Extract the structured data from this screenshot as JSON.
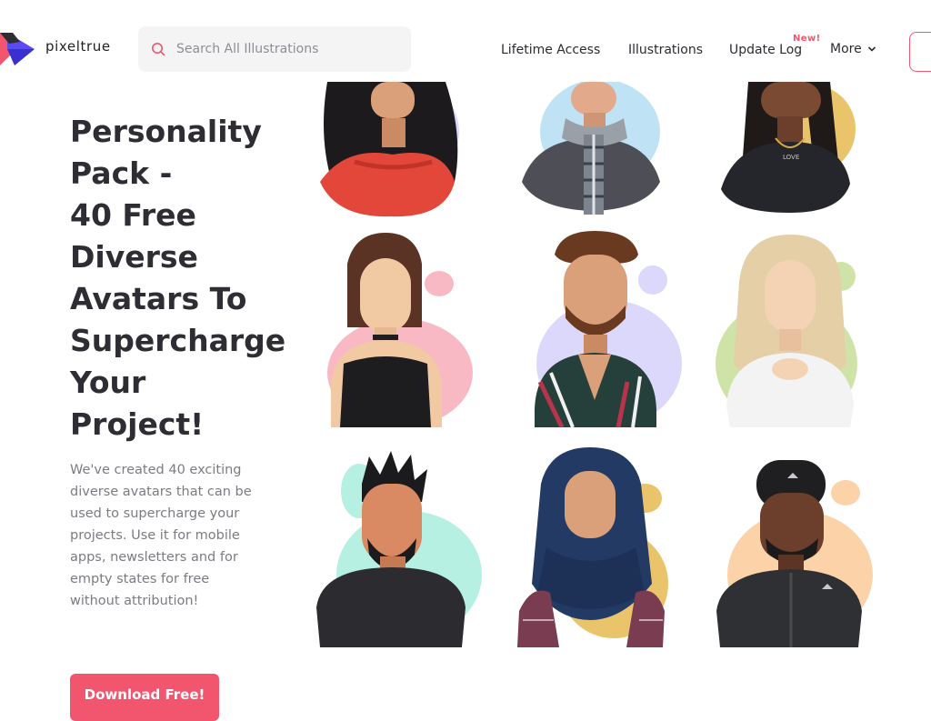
{
  "brand": {
    "name": "pixeltrue"
  },
  "search": {
    "placeholder": "Search All Illustrations"
  },
  "nav": {
    "items": [
      {
        "label": "Lifetime Access"
      },
      {
        "label": "Illustrations"
      },
      {
        "label": "Update Log"
      }
    ],
    "badge": "New!",
    "more_label": "More"
  },
  "hero": {
    "title_lines": [
      "Personality",
      "Pack -",
      "40 Free",
      "Diverse",
      "Avatars To",
      "Supercharge",
      "Your",
      "Project!"
    ],
    "description": "We've created 40 exciting diverse avatars that can be used to supercharge your projects. Use it for mobile apps, newsletters and for empty states for free without attribution!",
    "cta_label": "Download Free!"
  },
  "colors": {
    "accent": "#f1566e",
    "blob_lavender": "#dcd8fb",
    "blob_sky": "#bfe3f4",
    "blob_mustard": "#e9c46a",
    "blob_pink": "#f8b9c4",
    "blob_lime": "#cfe3a8",
    "blob_mint": "#b6f0e2",
    "blob_peach": "#fcd3a8"
  },
  "avatars": [
    {
      "name": "woman-red-top-avatar"
    },
    {
      "name": "man-plaid-scarf-avatar"
    },
    {
      "name": "woman-braids-avatar"
    },
    {
      "name": "woman-black-top-avatar"
    },
    {
      "name": "man-beard-striped-shirt-avatar"
    },
    {
      "name": "woman-blonde-sweater-avatar"
    },
    {
      "name": "man-spiky-hair-avatar"
    },
    {
      "name": "woman-hijab-avatar"
    },
    {
      "name": "man-black-cap-avatar"
    }
  ]
}
